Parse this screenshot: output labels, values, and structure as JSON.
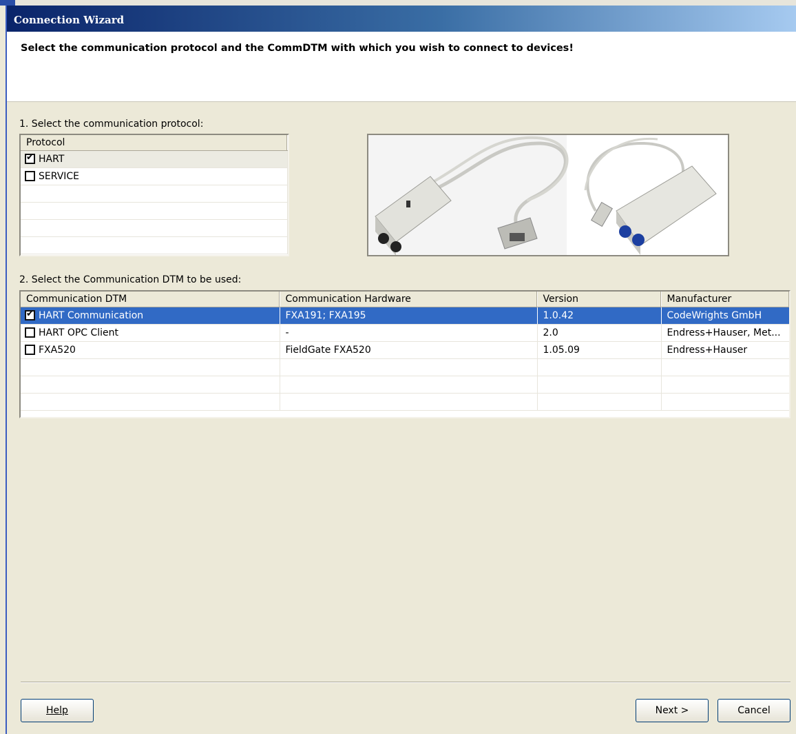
{
  "window": {
    "title": "Connection Wizard",
    "instruction": "Select the communication protocol and the CommDTM with which you wish to connect to devices!"
  },
  "step1": {
    "label": "1. Select the communication protocol:",
    "header": "Protocol",
    "rows": [
      {
        "name": "HART",
        "checked": true
      },
      {
        "name": "SERVICE",
        "checked": false
      }
    ]
  },
  "step2": {
    "label": "2. Select the Communication DTM to be used:",
    "columns": [
      "Communication DTM",
      "Communication Hardware",
      "Version",
      "Manufacturer"
    ],
    "rows": [
      {
        "dtm": "HART Communication",
        "hardware": "FXA191; FXA195",
        "version": "1.0.42",
        "manufacturer": "CodeWrights GmbH",
        "checked": true,
        "selected": true
      },
      {
        "dtm": "HART OPC Client",
        "hardware": "-",
        "version": "2.0",
        "manufacturer": "Endress+Hauser, Met...",
        "checked": false,
        "selected": false
      },
      {
        "dtm": "FXA520",
        "hardware": "FieldGate FXA520",
        "version": "1.05.09",
        "manufacturer": "Endress+Hauser",
        "checked": false,
        "selected": false
      }
    ]
  },
  "buttons": {
    "help": "Help",
    "next": "Next >",
    "cancel": "Cancel"
  },
  "colors": {
    "selection": "#316ac5",
    "title_gradient_start": "#0a246a",
    "dialog_bg": "#ece9d8"
  }
}
